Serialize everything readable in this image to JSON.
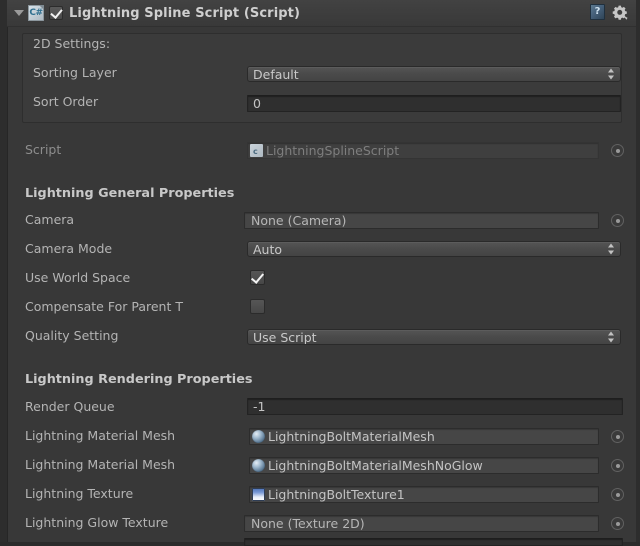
{
  "component": {
    "title": "Lightning Spline Script (Script)",
    "enabled_checkbox": true,
    "foldout_expanded": true,
    "script_type_icon": "csharp-script-icon",
    "help_icon": "help-book-icon",
    "help_glyph": "?",
    "settings_icon": "gear-icon",
    "accent_color": "#3d3d3d"
  },
  "two_d_settings": {
    "header": "2D Settings:",
    "sorting_layer": {
      "label": "Sorting Layer",
      "value": "Default",
      "control": "dropdown"
    },
    "sort_order": {
      "label": "Sort Order",
      "value": "0",
      "control": "number-field"
    }
  },
  "script_row": {
    "label": "Script",
    "value": "LightningSplineScript",
    "icon": "csharp-script-icon",
    "disabled": true
  },
  "general": {
    "header": "Lightning General Properties",
    "rows": [
      {
        "label": "Camera",
        "value": "None (Camera)",
        "control": "object-field",
        "icon": "",
        "picker": true
      },
      {
        "label": "Camera Mode",
        "value": "Auto",
        "control": "dropdown",
        "icon": "",
        "picker": false
      },
      {
        "label": "Use World Space",
        "value": "",
        "control": "checkbox",
        "checked": true,
        "icon": "",
        "picker": false
      },
      {
        "label": "Compensate For Parent T",
        "value": "",
        "control": "checkbox",
        "checked": false,
        "icon": "",
        "picker": false
      },
      {
        "label": "Quality Setting",
        "value": "Use Script",
        "control": "dropdown",
        "icon": "",
        "picker": false
      }
    ]
  },
  "rendering": {
    "header": "Lightning Rendering Properties",
    "rows": [
      {
        "label": "Render Queue",
        "value": "-1",
        "control": "number-field",
        "icon": "",
        "picker": false
      },
      {
        "label": "Lightning Material Mesh",
        "value": "LightningBoltMaterialMesh",
        "control": "object-field",
        "icon": "material-sphere-icon",
        "picker": true
      },
      {
        "label": "Lightning Material Mesh",
        "value": "LightningBoltMaterialMeshNoGlow",
        "control": "object-field",
        "icon": "material-sphere-icon",
        "picker": true
      },
      {
        "label": "Lightning Texture",
        "value": "LightningBoltTexture1",
        "control": "object-field",
        "icon": "texture-swatch-icon",
        "picker": true
      },
      {
        "label": "Lightning Glow Texture",
        "value": "None (Texture 2D)",
        "control": "object-field",
        "icon": "",
        "picker": true
      }
    ]
  }
}
